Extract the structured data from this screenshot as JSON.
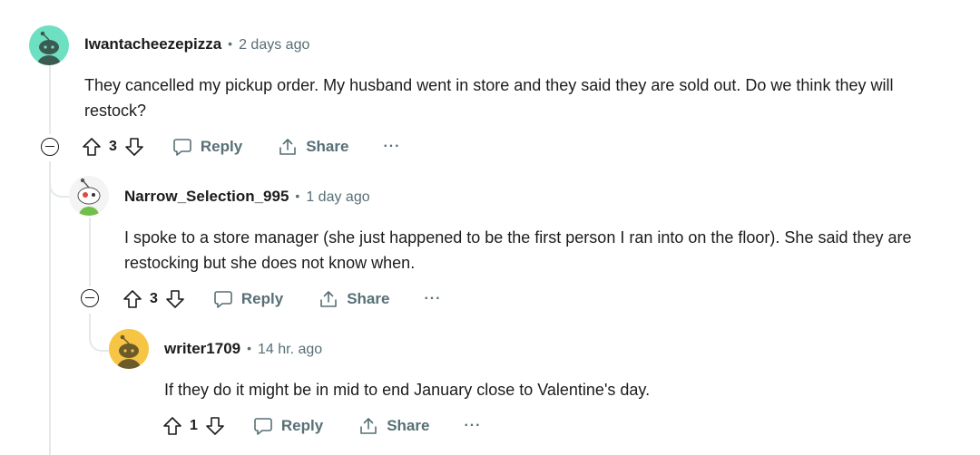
{
  "comments": [
    {
      "username": "Iwantacheezepizza",
      "separator": "•",
      "time": "2 days ago",
      "body": "They cancelled my pickup order. My husband went in store and they said they are sold out. Do we think they will restock?",
      "score": "3",
      "reply_label": "Reply",
      "share_label": "Share",
      "more_label": "···",
      "avatar_color": "#6ee0c2"
    },
    {
      "username": "Narrow_Selection_995",
      "separator": "•",
      "time": "1 day ago",
      "body": "I spoke to a store manager (she just happened to be the first person I ran into on the floor). She said they are restocking but she does not know when.",
      "score": "3",
      "reply_label": "Reply",
      "share_label": "Share",
      "more_label": "···",
      "avatar_color": "#f4f4f4"
    },
    {
      "username": "writer1709",
      "separator": "•",
      "time": "14 hr. ago",
      "body": "If they do it might be in mid to end January close to Valentine's day.",
      "score": "1",
      "reply_label": "Reply",
      "share_label": "Share",
      "more_label": "···",
      "avatar_color": "#f6c544"
    }
  ],
  "colors": {
    "text": "#1c1c1c",
    "meta": "#576f76",
    "thread_line": "#e5e8ea"
  }
}
